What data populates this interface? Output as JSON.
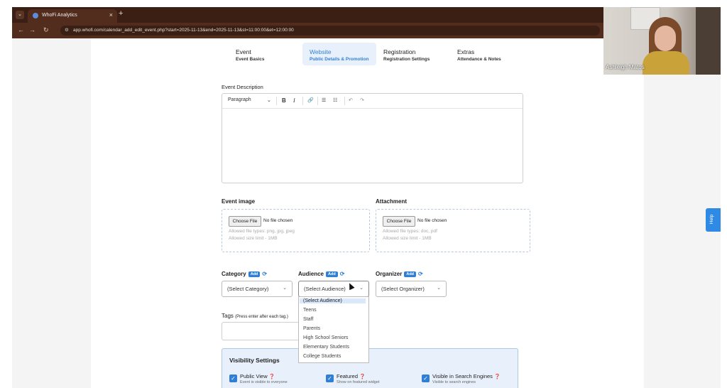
{
  "browser": {
    "tab_title": "WhoFi Analytics",
    "url": "app.whofi.com/calendar_add_edit_event.php?start=2025-11-13&end=2025-11-13&st=11:00:00&et=12:00:00"
  },
  "steps": [
    {
      "title": "Event",
      "subtitle": "Event Basics"
    },
    {
      "title": "Website",
      "subtitle": "Public Details & Promotion"
    },
    {
      "title": "Registration",
      "subtitle": "Registration Settings"
    },
    {
      "title": "Extras",
      "subtitle": "Attendance & Notes"
    }
  ],
  "description": {
    "label": "Event Description",
    "paragraph_select": "Paragraph"
  },
  "event_image": {
    "label": "Event image",
    "button": "Choose File",
    "status": "No file chosen",
    "hint_types": "Allowed file types: png, jpg, jpeg",
    "hint_size": "Allowed size limit - 1MB"
  },
  "attachment": {
    "label": "Attachment",
    "button": "Choose File",
    "status": "No file chosen",
    "hint_types": "Allowed file types: doc, pdf",
    "hint_size": "Allowed size limit - 1MB"
  },
  "category": {
    "label": "Category",
    "add": "Add",
    "value": "(Select Category)"
  },
  "audience": {
    "label": "Audience",
    "add": "Add",
    "value": "(Select Audience)",
    "options": [
      "(Select Audience)",
      "Teens",
      "Staff",
      "Parents",
      "High School Seniors",
      "Elementary Students",
      "College Students"
    ]
  },
  "organizer": {
    "label": "Organizer",
    "add": "Add",
    "value": "(Select Organizer)"
  },
  "tags": {
    "label": "Tags",
    "hint": "(Press enter after each tag.)"
  },
  "visibility": {
    "title": "Visibility Settings",
    "items": [
      {
        "label": "Public View",
        "desc": "Event is visible to everyone"
      },
      {
        "label": "Featured",
        "desc": "Show on featured widget"
      },
      {
        "label": "Visible in Search Engines",
        "desc": "Visible to search engines"
      }
    ]
  },
  "help_tab": "Help",
  "webcam": {
    "name": "Ashleigh Matos"
  }
}
